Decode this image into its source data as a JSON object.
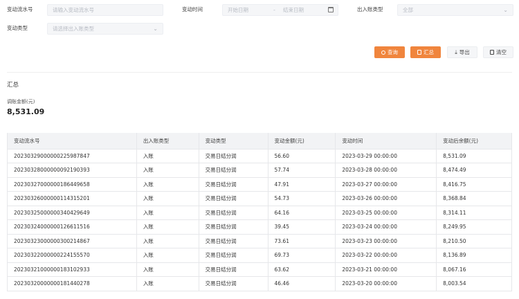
{
  "filters": {
    "serial": {
      "label": "变动流水号",
      "placeholder": "请输入变动流水号"
    },
    "time": {
      "label": "变动时间",
      "start_placeholder": "开始日期",
      "separator": "-",
      "end_placeholder": "结束日期"
    },
    "io_type": {
      "label": "出入账类型",
      "value": "全部"
    },
    "change_type": {
      "label": "变动类型",
      "placeholder": "请选择出入账类型"
    }
  },
  "buttons": {
    "query": "查询",
    "summary": "汇总",
    "export": "导出",
    "clear": "清空"
  },
  "summary": {
    "title": "汇总",
    "adjust_label": "调账金额(元)",
    "adjust_value": "8,531.09"
  },
  "table": {
    "headers": [
      "变动流水号",
      "出入账类型",
      "变动类型",
      "变动金额(元)",
      "变动时间",
      "变动后余额(元)"
    ],
    "rows": [
      [
        "20230329000000225987847",
        "入账",
        "交易日结分润",
        "56.60",
        "2023-03-29 00:00:00",
        "8,531.09"
      ],
      [
        "20230328000000092190393",
        "入账",
        "交易日结分润",
        "57.74",
        "2023-03-28 00:00:00",
        "8,474.49"
      ],
      [
        "20230327000000186449658",
        "入账",
        "交易日结分润",
        "47.91",
        "2023-03-27 00:00:00",
        "8,416.75"
      ],
      [
        "20230326000000114315201",
        "入账",
        "交易日结分润",
        "54.73",
        "2023-03-26 00:00:00",
        "8,368.84"
      ],
      [
        "20230325000000340429649",
        "入账",
        "交易日结分润",
        "64.16",
        "2023-03-25 00:00:00",
        "8,314.11"
      ],
      [
        "20230324000000126611516",
        "入账",
        "交易日结分润",
        "39.45",
        "2023-03-24 00:00:00",
        "8,249.95"
      ],
      [
        "20230323000000300214867",
        "入账",
        "交易日结分润",
        "73.61",
        "2023-03-23 00:00:00",
        "8,210.50"
      ],
      [
        "20230322000000224155570",
        "入账",
        "交易日结分润",
        "69.73",
        "2023-03-22 00:00:00",
        "8,136.89"
      ],
      [
        "20230321000000183102933",
        "入账",
        "交易日结分润",
        "63.62",
        "2023-03-21 00:00:00",
        "8,067.16"
      ],
      [
        "20230320000000181440278",
        "入账",
        "交易日结分润",
        "46.46",
        "2023-03-20 00:00:00",
        "8,003.54"
      ]
    ]
  }
}
